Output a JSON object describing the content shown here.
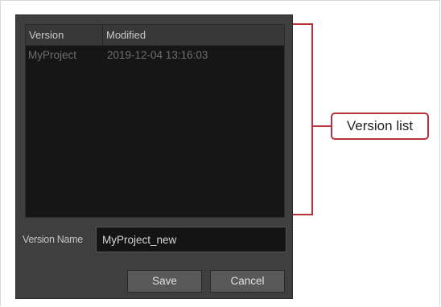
{
  "list": {
    "columns": [
      "Version",
      "Modified"
    ],
    "rows": [
      {
        "version": "MyProject",
        "modified": "2019-12-04 13:16:03"
      }
    ]
  },
  "version_name": {
    "label": "Version Name",
    "value": "MyProject_new"
  },
  "buttons": {
    "save": "Save",
    "cancel": "Cancel"
  },
  "callout": {
    "label": "Version list",
    "color": "#b8323a"
  }
}
